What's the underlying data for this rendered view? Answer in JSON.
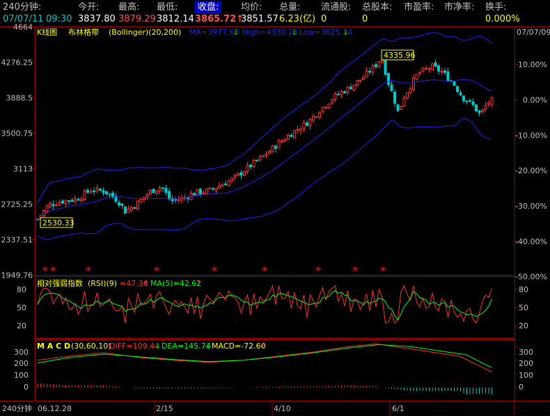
{
  "header": {
    "row1": [
      {
        "label": "240分钟:",
        "x": 4
      },
      {
        "label": "今开:",
        "x": 112
      },
      {
        "label": "最高:",
        "x": 170
      },
      {
        "label": "最低:",
        "x": 225
      },
      {
        "label": "收盘:",
        "x": 280,
        "highlight": true
      },
      {
        "label": "均价:",
        "x": 346
      },
      {
        "label": "总量:",
        "x": 401
      },
      {
        "label": "流通股:",
        "x": 461
      },
      {
        "label": "总股本:",
        "x": 520
      },
      {
        "label": "市盈率:",
        "x": 580
      },
      {
        "label": "市净率:",
        "x": 638
      },
      {
        "label": "换手:",
        "x": 697
      }
    ],
    "date": "07/07/11",
    "time": "09:30",
    "open": "3837.80",
    "high": "3879.29",
    "low": "3812.14",
    "close": "3865.72",
    "close_arrow": "↑",
    "avg": "3851.57",
    "volume": "6.23(亿)",
    "float_shares": "0",
    "total_shares": "0",
    "turnover": "0.000%"
  },
  "main_panel": {
    "k_label": "K线图",
    "indicator_name": "布林格带",
    "indicator_en": "(Bollinger)(20,200)",
    "ma_text": "MA=3977.63",
    "high_text": "High=4330.25",
    "low_text": "Low=3625.14",
    "down_arrow": "↓",
    "top_date": "07/07/09",
    "max_label": "4335.96",
    "min_label": "2530.33",
    "left_ticks": [
      "4664",
      "4276.25",
      "3888.5",
      "3500.75",
      "3113",
      "2725.25",
      "2337.51",
      "1949.76"
    ],
    "right_ticks": [
      "10.00%",
      "0.00%",
      "-10.00%",
      "-20.00%",
      "-30.00%",
      "-40.00%",
      "-50.00%"
    ]
  },
  "rsi_panel": {
    "name": "相对强弱指数",
    "param": "(RSI)(9)",
    "value_text": "=47.36",
    "ma_text": "MA(5)=42.62",
    "up_arrow": "↑",
    "ticks": [
      "80",
      "50",
      "20"
    ]
  },
  "macd_panel": {
    "name": "M A C D",
    "param": "(30,60,10)",
    "diff_text": "DIFF=109.44",
    "dea_text": "DEA=145.74",
    "macd_text": "MACD=-72.60",
    "ticks": [
      "300",
      "200",
      "100",
      "0"
    ]
  },
  "xaxis": {
    "corner": "240分钟",
    "labels": [
      "06.12.28",
      "2/15",
      "4/10",
      "6/1"
    ]
  },
  "chart_data": {
    "type": "candlestick",
    "ylim": [
      1949.76,
      4664
    ],
    "max_high": 4335.96,
    "min_low": 2530.33,
    "last_close": 3865.72,
    "rsi_ylim": [
      0,
      100
    ],
    "macd_ylim": [
      -100,
      350
    ],
    "colors": {
      "up": "#ff3030",
      "down": "#00c8c8",
      "band": "#2020ff",
      "rsi": "#ff3030",
      "rsi_ma": "#00ff00",
      "diff": "#ff3030",
      "dea": "#00ff00"
    }
  }
}
